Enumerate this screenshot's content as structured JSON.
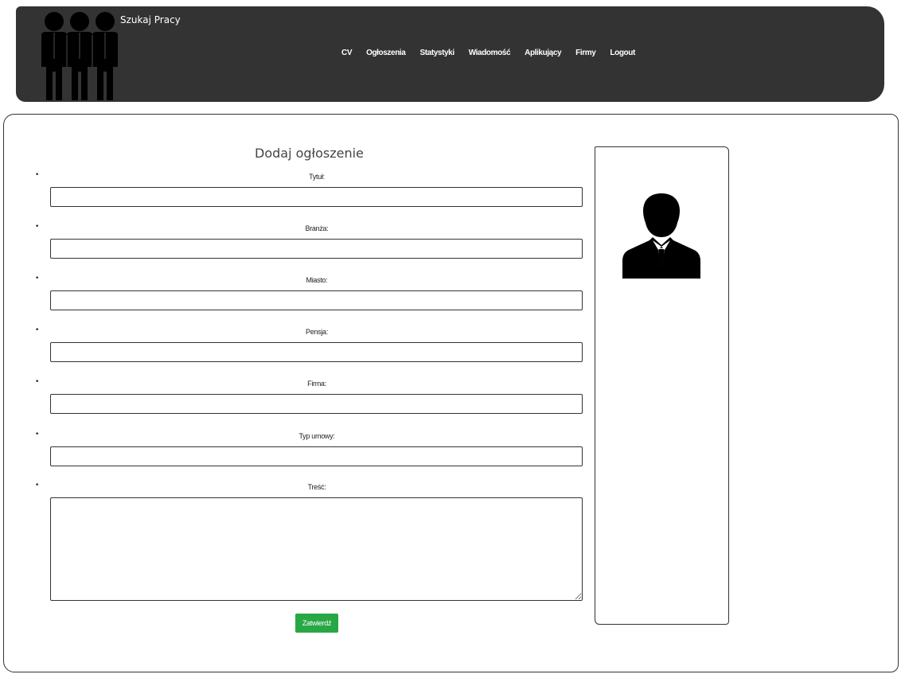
{
  "header": {
    "site_title": "Szukaj Pracy",
    "logo_icon": "group-of-people-icon",
    "nav": [
      {
        "label": "CV"
      },
      {
        "label": "Ogłoszenia"
      },
      {
        "label": "Statystyki"
      },
      {
        "label": "Wiadomość"
      },
      {
        "label": "Aplikujący"
      },
      {
        "label": "Firmy"
      },
      {
        "label": "Logout"
      }
    ],
    "background_color": "#333333"
  },
  "form": {
    "title": "Dodaj ogłoszenie",
    "fields": [
      {
        "label": "Tytuł:",
        "value": "",
        "placeholder": ""
      },
      {
        "label": "Branża:",
        "value": "",
        "placeholder": ""
      },
      {
        "label": "Miasto:",
        "value": "",
        "placeholder": ""
      },
      {
        "label": "Pensja:",
        "value": "",
        "placeholder": ""
      },
      {
        "label": "Firma:",
        "value": "",
        "placeholder": ""
      },
      {
        "label": "Typ umowy:",
        "value": "",
        "placeholder": ""
      },
      {
        "label": "Treść:",
        "value": "",
        "placeholder": ""
      }
    ],
    "submit_label": "Zatwierdź",
    "submit_color": "#28a745"
  },
  "profile": {
    "avatar_icon": "user-avatar-icon"
  }
}
